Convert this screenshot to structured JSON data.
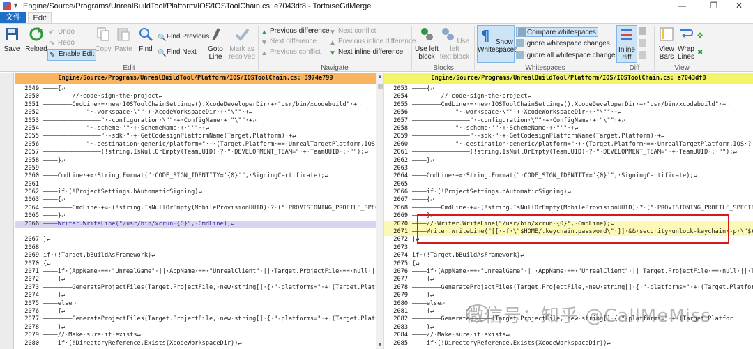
{
  "window": {
    "title": "Engine/Source/Programs/UnrealBuildTool/Platform/IOS/IOSToolChain.cs: e7043df8 - TortoiseGitMerge",
    "minimize": "—",
    "maximize": "❐",
    "close": "✕"
  },
  "tabs": {
    "file": "文件",
    "edit": "Edit"
  },
  "ribbon": {
    "save": "Save",
    "reload": "Reload",
    "undo": "Undo",
    "redo": "Redo",
    "enable_edit": "Enable Edit",
    "copy": "Copy",
    "paste": "Paste",
    "find": "Find",
    "find_previous": "Find Previous",
    "find_next": "Find Next",
    "goto_line_1": "Goto",
    "goto_line_2": "Line",
    "mark_resolved_1": "Mark as",
    "mark_resolved_2": "resolved",
    "prev_difference": "Previous difference",
    "next_difference": "Next difference",
    "prev_conflict": "Previous conflict",
    "next_conflict": "Next conflict",
    "prev_inline_diff": "Previous inline difference",
    "next_inline_diff": "Next inline difference",
    "use_left_block_1": "Use left",
    "use_left_block_2": "block",
    "use_left_text_block_1": "Use left",
    "use_left_text_block_2": "text block",
    "show_whitespaces_1": "Show",
    "show_whitespaces_2": "Whitespaces",
    "compare_whitespaces": "Compare whitespaces",
    "ignore_whitespace_changes": "Ignore whitespace changes",
    "ignore_all_whitespace_changes": "Ignore all whitespace changes",
    "inline_diff_1": "Inline",
    "inline_diff_2": "diff",
    "view_bars_1": "View",
    "view_bars_2": "Bars",
    "wrap_lines_1": "Wrap",
    "wrap_lines_2": "Lines",
    "groups": {
      "edit": "Edit",
      "navigate": "Navigate",
      "blocks": "Blocks",
      "whitespaces": "Whitespaces",
      "diff": "Diff",
      "view": "View"
    }
  },
  "left_pane": {
    "header": "Engine/Source/Programs/UnrealBuildTool/Platform/IOS/IOSToolChain.cs: 3974e799",
    "lines": [
      {
        "n": "2049",
        "t": "————{↵",
        "s": ""
      },
      {
        "n": "2050",
        "t": "————————//·code·sign·the·project↵",
        "s": ""
      },
      {
        "n": "2051",
        "t": "————————CmdLine·=·new·IOSToolChainSettings().XcodeDeveloperDir·+·\"usr/bin/xcodebuild\"·+↵",
        "s": ""
      },
      {
        "n": "2052",
        "t": "————————————\"·-workspace·\\\"\"·+·XcodeWorkspaceDir·+·\"\\\"\"·+↵",
        "s": ""
      },
      {
        "n": "2053",
        "t": "————————————————\"·-configuration·\\\"\"·+·ConfigName·+·\"\\\"\"·+↵",
        "s": ""
      },
      {
        "n": "2054",
        "t": "————————————\"·-scheme·'\"·+·SchemeName·+·\"'\"·+↵",
        "s": ""
      },
      {
        "n": "2055",
        "t": "————————————————\"·-sdk·\"·+·GetCodesignPlatformName(Target.Platform)·+↵",
        "s": ""
      },
      {
        "n": "2056",
        "t": "————————————\"·-destination·generic/platform=\"·+·(Target.Platform·==·UnrealTargetPlatform.IOS·?",
        "s": ""
      },
      {
        "n": "2057",
        "t": "————————————————(!string.IsNullOrEmpty(TeamUUID)·?·\"·DEVELOPMENT_TEAM=\"·+·TeamUUID·:·\"\");↵",
        "s": ""
      },
      {
        "n": "2058",
        "t": "————}↵",
        "s": ""
      },
      {
        "n": "2059",
        "t": "",
        "s": ""
      },
      {
        "n": "2060",
        "t": "————CmdLine·+=·String.Format(\"·CODE_SIGN_IDENTITY='{0}'\",·SigningCertificate);↵",
        "s": ""
      },
      {
        "n": "2061",
        "t": "",
        "s": ""
      },
      {
        "n": "2062",
        "t": "————if·(!ProjectSettings.bAutomaticSigning)↵",
        "s": ""
      },
      {
        "n": "2063",
        "t": "————{↵",
        "s": ""
      },
      {
        "n": "2064",
        "t": "————————CmdLine·+=·(!string.IsNullOrEmpty(MobileProvisionUUID)·?·(\"·PROVISIONING_PROFILE_SPECIF",
        "s": ""
      },
      {
        "n": "2065",
        "t": "————}↵",
        "s": ""
      },
      {
        "n": "2066",
        "t": "————Writer.WriteLine(\"/usr/bin/xcrun·{0}\",·CmdLine);↵",
        "s": "removed"
      },
      {
        "n": "",
        "t": "",
        "s": "empty"
      },
      {
        "n": "2067",
        "t": "}↵",
        "s": ""
      },
      {
        "n": "2068",
        "t": "",
        "s": ""
      },
      {
        "n": "2069",
        "t": "if·(!Target.bBuildAsFramework)↵",
        "s": ""
      },
      {
        "n": "2070",
        "t": "{↵",
        "s": ""
      },
      {
        "n": "2071",
        "t": "————if·(AppName·==·\"UnrealGame\"·||·AppName·==·\"UnrealClient\"·||·Target.ProjectFile·==·null·||·T",
        "s": ""
      },
      {
        "n": "2072",
        "t": "————{↵",
        "s": ""
      },
      {
        "n": "2073",
        "t": "————————GenerateProjectFiles(Target.ProjectFile,·new·string[]·{·\"-platforms=\"·+·(Target.Platfor",
        "s": ""
      },
      {
        "n": "2074",
        "t": "————}↵",
        "s": ""
      },
      {
        "n": "2075",
        "t": "————else↵",
        "s": ""
      },
      {
        "n": "2076",
        "t": "————{↵",
        "s": ""
      },
      {
        "n": "2077",
        "t": "————————GenerateProjectFiles(Target.ProjectFile,·new·string[]·{·\"-platforms=\"·+·(Target.Platfor",
        "s": ""
      },
      {
        "n": "2078",
        "t": "————}↵",
        "s": ""
      },
      {
        "n": "2079",
        "t": "————//·Make·sure·it·exists↵",
        "s": ""
      },
      {
        "n": "2080",
        "t": "————if·(!DirectoryReference.Exists(XcodeWorkspaceDir))↵",
        "s": ""
      }
    ]
  },
  "right_pane": {
    "header": "Engine/Source/Programs/UnrealBuildTool/Platform/IOS/IOSToolChain.cs: e7043df8",
    "lines": [
      {
        "n": "2053",
        "t": "————{↵",
        "s": ""
      },
      {
        "n": "2054",
        "t": "————————//·code·sign·the·project↵",
        "s": ""
      },
      {
        "n": "2055",
        "t": "————————CmdLine·=·new·IOSToolChainSettings().XcodeDeveloperDir·+·\"usr/bin/xcodebuild\"·+↵",
        "s": ""
      },
      {
        "n": "2056",
        "t": "————————————\"·-workspace·\\\"\"·+·XcodeWorkspaceDir·+·\"\\\"\"·+↵",
        "s": ""
      },
      {
        "n": "2057",
        "t": "————————————————\"·-configuration·\\\"\"·+·ConfigName·+·\"\\\"\"·+↵",
        "s": ""
      },
      {
        "n": "2058",
        "t": "————————————\"·-scheme·'\"·+·SchemeName·+·\"'\"·+↵",
        "s": ""
      },
      {
        "n": "2059",
        "t": "————————————————\"·-sdk·\"·+·GetCodesignPlatformName(Target.Platform)·+↵",
        "s": ""
      },
      {
        "n": "2060",
        "t": "————————————\"·-destination·generic/platform=\"·+·(Target.Platform·==·UnrealTargetPlatform.IOS·?",
        "s": ""
      },
      {
        "n": "2061",
        "t": "————————————————(!string.IsNullOrEmpty(TeamUUID)·?·\"·DEVELOPMENT_TEAM=\"·+·TeamUUID·:·\"\");↵",
        "s": ""
      },
      {
        "n": "2062",
        "t": "————}↵",
        "s": ""
      },
      {
        "n": "2063",
        "t": "",
        "s": ""
      },
      {
        "n": "2064",
        "t": "————CmdLine·+=·String.Format(\"·CODE_SIGN_IDENTITY='{0}'\",·SigningCertificate);↵",
        "s": ""
      },
      {
        "n": "2065",
        "t": "",
        "s": ""
      },
      {
        "n": "2066",
        "t": "————if·(!ProjectSettings.bAutomaticSigning)↵",
        "s": ""
      },
      {
        "n": "2067",
        "t": "————{↵",
        "s": ""
      },
      {
        "n": "2068",
        "t": "————————CmdLine·+=·(!string.IsNullOrEmpty(MobileProvisionUUID)·?·(\"·PROVISIONING_PROFILE_SPECIF",
        "s": ""
      },
      {
        "n": "2069",
        "t": "————}↵",
        "s": ""
      },
      {
        "n": "2070",
        "t": "————//·Writer.WriteLine(\"/usr/bin/xcrun·{0}\",·CmdLine);↵",
        "s": "added"
      },
      {
        "n": "2071",
        "t": "————Writer.WriteLine(\"[[·-f·\\\"$HOME/.keychain.password\\\"·]]·&&·security·unlock-keychain·-p·\\\"$(",
        "s": "added"
      },
      {
        "n": "2072",
        "t": "}↵",
        "s": ""
      },
      {
        "n": "2073",
        "t": "",
        "s": ""
      },
      {
        "n": "2074",
        "t": "if·(!Target.bBuildAsFramework)↵",
        "s": ""
      },
      {
        "n": "2075",
        "t": "{↵",
        "s": ""
      },
      {
        "n": "2076",
        "t": "————if·(AppName·==·\"UnrealGame\"·||·AppName·==·\"UnrealClient\"·||·Target.ProjectFile·==·null·||·T",
        "s": ""
      },
      {
        "n": "2077",
        "t": "————{↵",
        "s": ""
      },
      {
        "n": "2078",
        "t": "————————GenerateProjectFiles(Target.ProjectFile,·new·string[]·{·\"-platforms=\"·+·(Target.Platfor",
        "s": ""
      },
      {
        "n": "2079",
        "t": "————}↵",
        "s": ""
      },
      {
        "n": "2080",
        "t": "————else↵",
        "s": ""
      },
      {
        "n": "2081",
        "t": "————{↵",
        "s": ""
      },
      {
        "n": "2082",
        "t": "————————Generate——————(Target.ProjectFile,·new·string[]·{·\"-platforms=\"·+·(Target.Platfor",
        "s": ""
      },
      {
        "n": "2083",
        "t": "————}↵",
        "s": ""
      },
      {
        "n": "2084",
        "t": "————//·Make·sure·it·exists↵",
        "s": ""
      },
      {
        "n": "2085",
        "t": "————if·(!DirectoryReference.Exists(XcodeWorkspaceDir))↵",
        "s": ""
      }
    ]
  },
  "watermark": "微信号：知乎 @CallMeMiss",
  "colors": {
    "left_header": "#f9b462",
    "right_header": "#f4f46a",
    "removed": "#d9d5f0",
    "added": "#fbf9b5",
    "highlight": "#d41a1a",
    "file_tab": "#1e6ec8"
  }
}
